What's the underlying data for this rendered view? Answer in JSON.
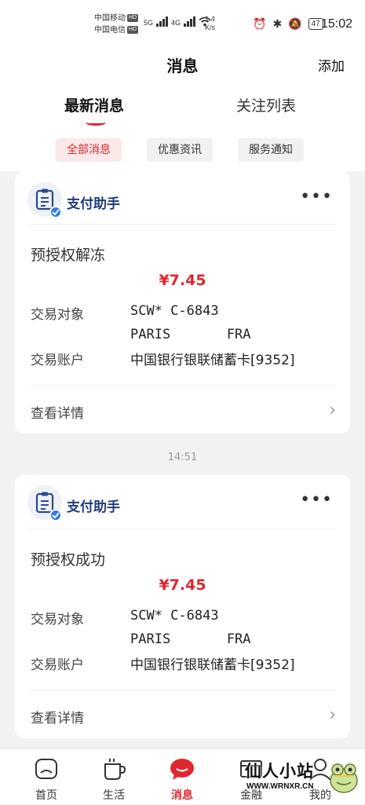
{
  "status_bar": {
    "carrier1": "中国移动",
    "carrier2": "中国电信",
    "hd": "HD",
    "net1": "5G",
    "net2": "4G",
    "speed_value": "1.4",
    "speed_unit": "K/s",
    "battery": "47",
    "time": "15:02"
  },
  "header": {
    "title": "消息",
    "follow_button": "添加"
  },
  "tabs": [
    {
      "label": "最新消息",
      "active": true
    },
    {
      "label": "关注列表",
      "active": false
    }
  ],
  "filters": [
    {
      "label": "全部消息",
      "selected": true
    },
    {
      "label": "优惠资讯",
      "selected": false
    },
    {
      "label": "服务通知",
      "selected": false
    }
  ],
  "messages": [
    {
      "sender": "支付助手",
      "title": "预授权解冻",
      "amount": "¥7.45",
      "counterparty_label": "交易对象",
      "counterparty_line1": "SCW* C-6843",
      "counterparty_line2": "PARIS       FRA",
      "account_label": "交易账户",
      "account_value": "中国银行银联储蓄卡[9352]",
      "detail_label": "查看详情"
    },
    {
      "sender": "支付助手",
      "title": "预授权成功",
      "amount": "¥7.45",
      "counterparty_label": "交易对象",
      "counterparty_line1": "SCW* C-6843",
      "counterparty_line2": "PARIS       FRA",
      "account_label": "交易账户",
      "account_value": "中国银行银联储蓄卡[9352]",
      "detail_label": "查看详情"
    }
  ],
  "timestamp": "14:51",
  "bottom_nav": [
    {
      "label": "首页",
      "icon": "home-icon",
      "active": false
    },
    {
      "label": "生活",
      "icon": "cup-icon",
      "active": false
    },
    {
      "label": "消息",
      "icon": "chat-icon",
      "active": true
    },
    {
      "label": "金融",
      "icon": "wallet-icon",
      "active": false
    },
    {
      "label": "我的",
      "icon": "user-icon",
      "active": false
    }
  ],
  "watermark": {
    "title": "仙人小站",
    "url": "WWW.WRNXR.CN"
  },
  "colors": {
    "accent": "#e0262e",
    "sender": "#1e3c7a",
    "verified": "#2f7bf0"
  }
}
